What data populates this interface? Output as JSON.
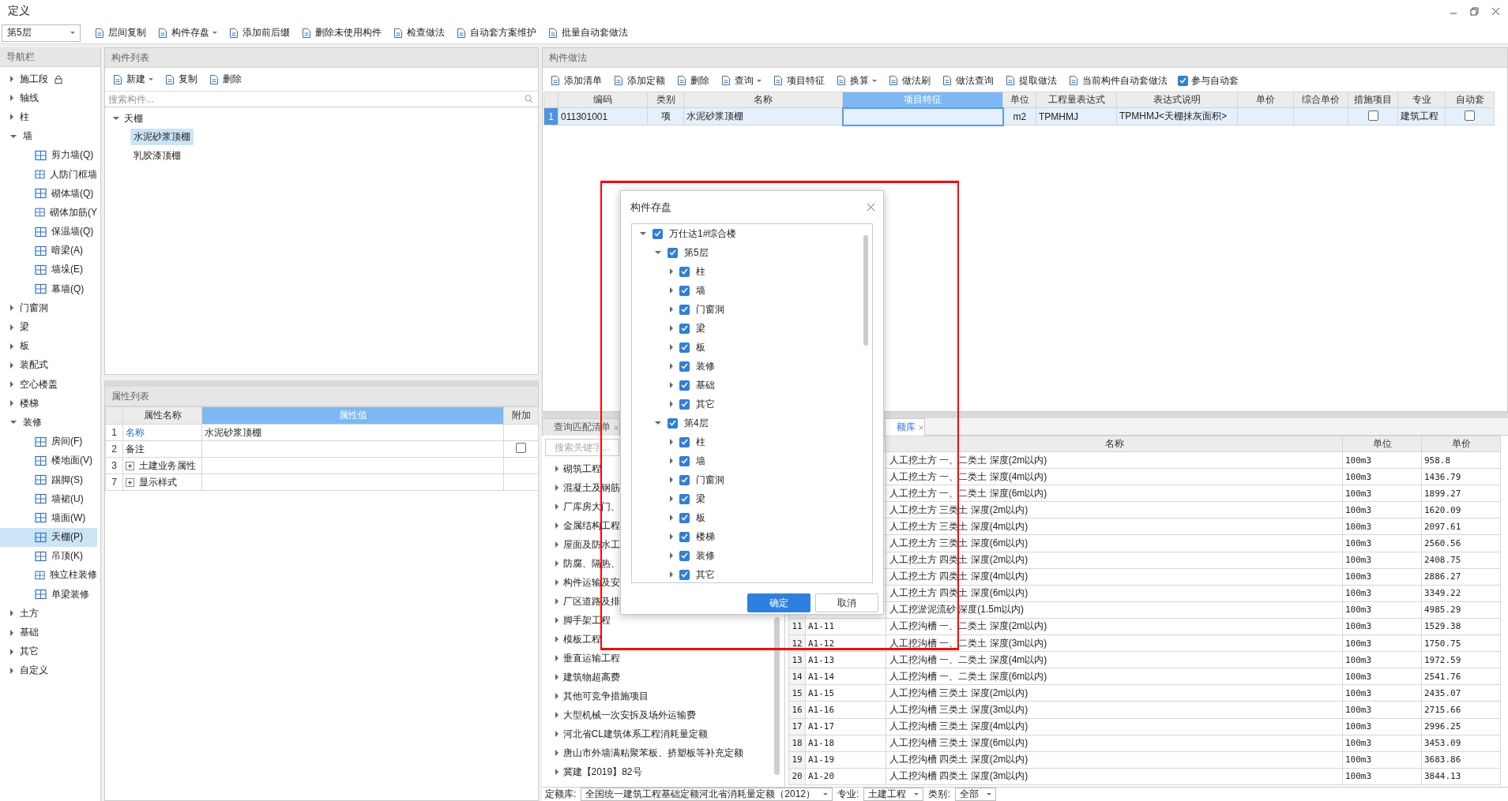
{
  "window": {
    "title": "定义"
  },
  "toolbar": {
    "floor_select": "第5层",
    "buttons": [
      {
        "label": "层间复制",
        "dropdown": false
      },
      {
        "label": "构件存盘",
        "dropdown": true
      },
      {
        "label": "添加前后缀",
        "dropdown": false
      },
      {
        "label": "删除未使用构件",
        "dropdown": false
      },
      {
        "label": "检查做法",
        "dropdown": false
      },
      {
        "label": "自动套方案维护",
        "dropdown": false
      },
      {
        "label": "批量自动套做法",
        "dropdown": false
      }
    ]
  },
  "nav": {
    "title": "导航栏",
    "items": [
      {
        "label": "施工段",
        "expanded": false,
        "locked": true
      },
      {
        "label": "轴线",
        "expanded": false,
        "locked": false
      },
      {
        "label": "柱",
        "expanded": false,
        "locked": false
      },
      {
        "label": "墙",
        "expanded": true,
        "locked": false,
        "children": [
          {
            "label": "剪力墙(Q)",
            "selected": false
          },
          {
            "label": "人防门框墙",
            "selected": false
          },
          {
            "label": "砌体墙(Q)",
            "selected": false
          },
          {
            "label": "砌体加筋(Y",
            "selected": false
          },
          {
            "label": "保温墙(Q)",
            "selected": false
          },
          {
            "label": "暗梁(A)",
            "selected": false
          },
          {
            "label": "墙垛(E)",
            "selected": false
          },
          {
            "label": "幕墙(Q)",
            "selected": false
          }
        ]
      },
      {
        "label": "门窗洞",
        "expanded": false,
        "locked": false
      },
      {
        "label": "梁",
        "expanded": false,
        "locked": false
      },
      {
        "label": "板",
        "expanded": false,
        "locked": false
      },
      {
        "label": "装配式",
        "expanded": false,
        "locked": false
      },
      {
        "label": "空心楼盖",
        "expanded": false,
        "locked": false
      },
      {
        "label": "楼梯",
        "expanded": false,
        "locked": false
      },
      {
        "label": "装修",
        "expanded": true,
        "locked": false,
        "children": [
          {
            "label": "房间(F)",
            "selected": false
          },
          {
            "label": "楼地面(V)",
            "selected": false
          },
          {
            "label": "踢脚(S)",
            "selected": false
          },
          {
            "label": "墙裙(U)",
            "selected": false
          },
          {
            "label": "墙面(W)",
            "selected": false
          },
          {
            "label": "天棚(P)",
            "selected": true
          },
          {
            "label": "吊顶(K)",
            "selected": false
          },
          {
            "label": "独立柱装修",
            "selected": false
          },
          {
            "label": "单梁装修",
            "selected": false
          }
        ]
      },
      {
        "label": "土方",
        "expanded": false,
        "locked": false
      },
      {
        "label": "基础",
        "expanded": false,
        "locked": false
      },
      {
        "label": "其它",
        "expanded": false,
        "locked": false
      },
      {
        "label": "自定义",
        "expanded": false,
        "locked": false
      }
    ]
  },
  "component_list": {
    "title": "构件列表",
    "buttons": [
      {
        "label": "新建",
        "dropdown": true
      },
      {
        "label": "复制",
        "dropdown": false
      },
      {
        "label": "删除",
        "dropdown": false
      }
    ],
    "search": {
      "placeholder": "搜索构件..."
    },
    "tree": [
      {
        "label": "天棚",
        "expanded": true,
        "children": [
          {
            "label": "水泥砂浆顶棚",
            "selected": true
          },
          {
            "label": "乳胶漆顶棚",
            "selected": false
          }
        ]
      }
    ]
  },
  "property_list": {
    "title": "属性列表",
    "columns": [
      {
        "label": "属性名称",
        "selected": false
      },
      {
        "label": "属性值",
        "selected": true
      },
      {
        "label": "附加",
        "selected": false
      }
    ],
    "rows": [
      {
        "index": "1",
        "kind": "key",
        "name": "名称",
        "value": "水泥砂浆顶棚"
      },
      {
        "index": "2",
        "kind": "checkbox",
        "name": "备注",
        "checked": false
      },
      {
        "index": "3",
        "kind": "group",
        "name": "土建业务属性",
        "expanded": false
      },
      {
        "index": "7",
        "kind": "group",
        "name": "显示样式",
        "expanded": false
      }
    ]
  },
  "methods": {
    "title": "构件做法",
    "buttons": [
      {
        "label": "添加清单",
        "dropdown": false
      },
      {
        "label": "添加定额",
        "dropdown": false
      },
      {
        "label": "删除",
        "dropdown": false
      },
      {
        "label": "查询",
        "dropdown": true
      },
      {
        "label": "项目特征",
        "dropdown": false
      },
      {
        "label": "换算",
        "dropdown": true
      },
      {
        "label": "做法刷",
        "dropdown": false
      },
      {
        "label": "做法查询",
        "dropdown": false
      },
      {
        "label": "提取做法",
        "dropdown": false
      },
      {
        "label": "当前构件自动套做法",
        "dropdown": false
      }
    ],
    "auto_checkbox": {
      "label": "参与自动套",
      "checked": true
    },
    "columns": [
      {
        "label": "编码",
        "kind": "text",
        "selected": false
      },
      {
        "label": "类别",
        "kind": "text",
        "selected": false
      },
      {
        "label": "名称",
        "kind": "text",
        "selected": false
      },
      {
        "label": "项目特征",
        "kind": "text",
        "selected": true
      },
      {
        "label": "单位",
        "kind": "text",
        "selected": false
      },
      {
        "label": "工程量表达式",
        "kind": "text",
        "selected": false
      },
      {
        "label": "表达式说明",
        "kind": "text",
        "selected": false
      },
      {
        "label": "单价",
        "kind": "text",
        "selected": false
      },
      {
        "label": "综合单价",
        "kind": "text",
        "selected": false
      },
      {
        "label": "措施项目",
        "kind": "check",
        "selected": false
      },
      {
        "label": "专业",
        "kind": "text",
        "selected": false
      },
      {
        "label": "自动套",
        "kind": "check",
        "selected": false
      }
    ],
    "rows": [
      {
        "index": "1",
        "selected": true,
        "cells": [
          "011301001",
          "项",
          "水泥砂浆顶棚",
          null,
          "m2",
          "TPMHMJ",
          "TPMHMJ<天棚抹灰面积>",
          null,
          null,
          false,
          "建筑工程",
          false
        ]
      }
    ]
  },
  "lookup": {
    "tabs": [
      {
        "label": "查询匹配清单",
        "selected": false
      },
      {
        "label": "额库",
        "selected": true
      }
    ],
    "search": {
      "placeholder": "搜索关键字..."
    },
    "tree": [
      {
        "label": "砌筑工程",
        "expanded": false
      },
      {
        "label": "混凝土及钢筋",
        "expanded": false
      },
      {
        "label": "厂库房大门、",
        "expanded": false
      },
      {
        "label": "金属结构工程",
        "expanded": false
      },
      {
        "label": "屋面及防水工",
        "expanded": false
      },
      {
        "label": "防腐、隔热、",
        "expanded": false
      },
      {
        "label": "构件运输及安",
        "expanded": false
      },
      {
        "label": "厂区道路及排",
        "expanded": false
      },
      {
        "label": "脚手架工程",
        "expanded": false
      },
      {
        "label": "模板工程",
        "expanded": false
      },
      {
        "label": "垂直运输工程",
        "expanded": false
      },
      {
        "label": "建筑物超高费",
        "expanded": false
      },
      {
        "label": "其他可竞争措施项目",
        "expanded": false
      },
      {
        "label": "大型机械一次安拆及场外运输费",
        "expanded": false
      },
      {
        "label": "河北省CL建筑体系工程消耗量定额",
        "expanded": false
      },
      {
        "label": "唐山市外墙满粘聚苯板、挤塑板等补充定额",
        "expanded": false
      },
      {
        "label": "冀建【2019】82号",
        "expanded": false
      }
    ],
    "columns": [
      "名称",
      "单位",
      "单价"
    ],
    "rows": [
      {
        "name": "人工挖土方 一、二类土 深度(2m以内)",
        "unit": "100m3",
        "price": "958.8"
      },
      {
        "name": "人工挖土方 一、二类土 深度(4m以内)",
        "unit": "100m3",
        "price": "1436.79"
      },
      {
        "name": "人工挖土方 一、二类土 深度(6m以内)",
        "unit": "100m3",
        "price": "1899.27"
      },
      {
        "name": "人工挖土方 三类土 深度(2m以内)",
        "unit": "100m3",
        "price": "1620.09"
      },
      {
        "name": "人工挖土方 三类土 深度(4m以内)",
        "unit": "100m3",
        "price": "2097.61"
      },
      {
        "name": "人工挖土方 三类土 深度(6m以内)",
        "unit": "100m3",
        "price": "2560.56"
      },
      {
        "name": "人工挖土方 四类土 深度(2m以内)",
        "unit": "100m3",
        "price": "2408.75"
      },
      {
        "name": "人工挖土方 四类土 深度(4m以内)",
        "unit": "100m3",
        "price": "2886.27"
      },
      {
        "name": "人工挖土方 四类土 深度(6m以内)",
        "unit": "100m3",
        "price": "3349.22"
      },
      {
        "name": "人工挖淤泥流砂 深度(1.5m以内)",
        "unit": "100m3",
        "price": "4985.29"
      },
      {
        "index": "11",
        "code": "A1-11",
        "name": "人工挖沟槽 一、二类土 深度(2m以内)",
        "unit": "100m3",
        "price": "1529.38"
      },
      {
        "index": "12",
        "code": "A1-12",
        "name": "人工挖沟槽 一、二类土 深度(3m以内)",
        "unit": "100m3",
        "price": "1750.75"
      },
      {
        "index": "13",
        "code": "A1-13",
        "name": "人工挖沟槽 一、二类土 深度(4m以内)",
        "unit": "100m3",
        "price": "1972.59"
      },
      {
        "index": "14",
        "code": "A1-14",
        "name": "人工挖沟槽 一、二类土 深度(6m以内)",
        "unit": "100m3",
        "price": "2541.76"
      },
      {
        "index": "15",
        "code": "A1-15",
        "name": "人工挖沟槽 三类土 深度(2m以内)",
        "unit": "100m3",
        "price": "2435.07"
      },
      {
        "index": "16",
        "code": "A1-16",
        "name": "人工挖沟槽 三类土 深度(3m以内)",
        "unit": "100m3",
        "price": "2715.66"
      },
      {
        "index": "17",
        "code": "A1-17",
        "name": "人工挖沟槽 三类土 深度(4m以内)",
        "unit": "100m3",
        "price": "2996.25"
      },
      {
        "index": "18",
        "code": "A1-18",
        "name": "人工挖沟槽 三类土 深度(6m以内)",
        "unit": "100m3",
        "price": "3453.09"
      },
      {
        "index": "19",
        "code": "A1-19",
        "name": "人工挖沟槽 四类土 深度(2m以内)",
        "unit": "100m3",
        "price": "3683.86"
      },
      {
        "index": "20",
        "code": "A1-20",
        "name": "人工挖沟槽 四类土 深度(3m以内)",
        "unit": "100m3",
        "price": "3844.13"
      }
    ],
    "filters": [
      {
        "label": "定额库:",
        "value": "全国统一建筑工程基础定额河北省消耗量定额（2012）"
      },
      {
        "label": "专业:",
        "value": "土建工程"
      },
      {
        "label": "类别:",
        "value": "全部"
      }
    ]
  },
  "dialog": {
    "title": "构件存盘",
    "tree": [
      {
        "label": "万仕达1#综合楼",
        "checked": true,
        "expanded": true,
        "children": [
          {
            "label": "第5层",
            "checked": true,
            "expanded": true,
            "children": [
              {
                "label": "柱",
                "checked": true,
                "expanded": false
              },
              {
                "label": "墙",
                "checked": true,
                "expanded": false
              },
              {
                "label": "门窗洞",
                "checked": true,
                "expanded": false
              },
              {
                "label": "梁",
                "checked": true,
                "expanded": false
              },
              {
                "label": "板",
                "checked": true,
                "expanded": false
              },
              {
                "label": "装修",
                "checked": true,
                "expanded": false
              },
              {
                "label": "基础",
                "checked": true,
                "expanded": false
              },
              {
                "label": "其它",
                "checked": true,
                "expanded": false
              }
            ]
          },
          {
            "label": "第4层",
            "checked": true,
            "expanded": true,
            "children": [
              {
                "label": "柱",
                "checked": true,
                "expanded": false
              },
              {
                "label": "墙",
                "checked": true,
                "expanded": false
              },
              {
                "label": "门窗洞",
                "checked": true,
                "expanded": false
              },
              {
                "label": "梁",
                "checked": true,
                "expanded": false
              },
              {
                "label": "板",
                "checked": true,
                "expanded": false
              },
              {
                "label": "楼梯",
                "checked": true,
                "expanded": false
              },
              {
                "label": "装修",
                "checked": true,
                "expanded": false
              },
              {
                "label": "其它",
                "checked": true,
                "expanded": false
              }
            ]
          }
        ]
      }
    ],
    "buttons": [
      {
        "label": "确定",
        "kind": "primary"
      },
      {
        "label": "取消",
        "kind": "secondary"
      }
    ]
  },
  "annotation": {
    "kind": "rectangle",
    "color": "#ff0000"
  }
}
